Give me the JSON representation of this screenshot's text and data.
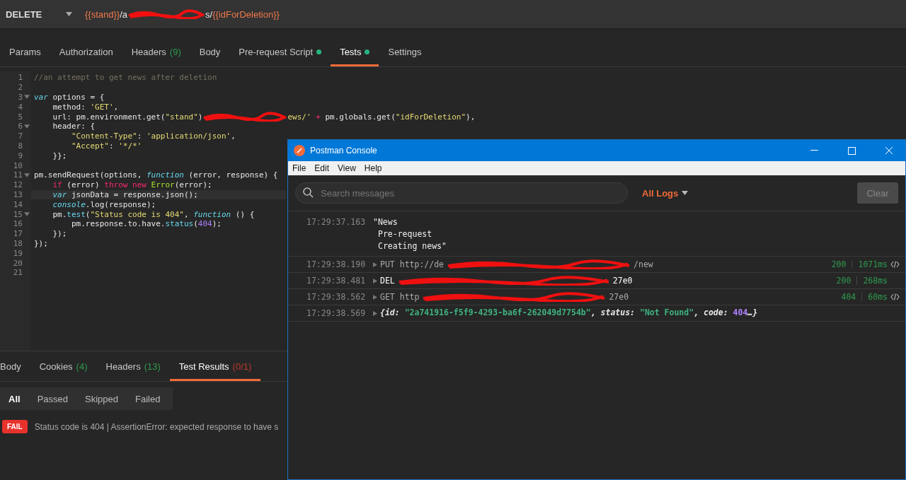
{
  "request": {
    "method": "DELETE",
    "url": [
      {
        "t": "{{stand}}",
        "kind": "var"
      },
      {
        "t": "/a",
        "kind": "plain"
      },
      {
        "kind": "redaction"
      },
      {
        "t": "s/",
        "kind": "plain"
      },
      {
        "t": "{{idForDeletion}}",
        "kind": "var"
      }
    ]
  },
  "request_tabs": [
    {
      "label": "Params",
      "selected": false
    },
    {
      "label": "Authorization",
      "selected": false
    },
    {
      "label": "Headers",
      "count": "(9)",
      "selected": false
    },
    {
      "label": "Body",
      "selected": false
    },
    {
      "label": "Pre-request Script",
      "dot": true,
      "selected": false
    },
    {
      "label": "Tests",
      "dot": true,
      "selected": true
    },
    {
      "label": "Settings",
      "selected": false
    }
  ],
  "editor": {
    "lines": [
      {
        "n": "1",
        "foldable": false,
        "current": false,
        "tokens": [
          {
            "t": "//an attempt to get news after deletion",
            "kind": "comment"
          }
        ]
      },
      {
        "n": "2",
        "foldable": false,
        "current": false
      },
      {
        "n": "3",
        "foldable": true,
        "current": false,
        "tokens": [
          {
            "t": "var",
            "kind": "keyword"
          },
          {
            "t": " options = {",
            "kind": "plain"
          }
        ]
      },
      {
        "n": "4",
        "foldable": false,
        "current": false,
        "tokens": [
          {
            "t": "    method: ",
            "kind": "plain"
          },
          {
            "t": "'GET'",
            "kind": "string"
          },
          {
            "t": ",",
            "kind": "plain"
          }
        ]
      },
      {
        "n": "5",
        "foldable": false,
        "current": false,
        "tokens": [
          {
            "t": "    url: pm.environment.get(",
            "kind": "plain"
          },
          {
            "t": "\"stand\"",
            "kind": "string"
          },
          {
            "t": ")",
            "kind": "plain"
          },
          {
            "kind": "redaction"
          },
          {
            "t": "ews/'",
            "kind": "string"
          },
          {
            "t": " + ",
            "kind": "operator"
          },
          {
            "t": "pm.globals.get(",
            "kind": "plain"
          },
          {
            "t": "\"idForDeletion\"",
            "kind": "string"
          },
          {
            "t": "),",
            "kind": "plain"
          }
        ]
      },
      {
        "n": "6",
        "foldable": true,
        "current": false,
        "tokens": [
          {
            "t": "    header: {",
            "kind": "plain"
          }
        ]
      },
      {
        "n": "7",
        "foldable": false,
        "current": false,
        "tokens": [
          {
            "t": "        \"Content-Type\"",
            "kind": "string"
          },
          {
            "t": ": ",
            "kind": "plain"
          },
          {
            "t": "'application/json'",
            "kind": "string"
          },
          {
            "t": ",",
            "kind": "plain"
          }
        ]
      },
      {
        "n": "8",
        "foldable": false,
        "current": false,
        "tokens": [
          {
            "t": "        \"Accept\"",
            "kind": "string"
          },
          {
            "t": ": ",
            "kind": "plain"
          },
          {
            "t": "'*/*'",
            "kind": "string"
          }
        ]
      },
      {
        "n": "9",
        "foldable": false,
        "current": false,
        "tokens": [
          {
            "t": "    }};",
            "kind": "plain"
          }
        ]
      },
      {
        "n": "10",
        "foldable": false,
        "current": false
      },
      {
        "n": "11",
        "foldable": true,
        "current": false,
        "tokens": [
          {
            "t": "pm.sendRequest(options, ",
            "kind": "plain"
          },
          {
            "t": "function",
            "kind": "keyword"
          },
          {
            "t": " (error, response) {",
            "kind": "plain"
          }
        ]
      },
      {
        "n": "12",
        "foldable": false,
        "current": false,
        "tokens": [
          {
            "t": "    if",
            "kind": "operator"
          },
          {
            "t": " (error) ",
            "kind": "plain"
          },
          {
            "t": "throw new",
            "kind": "operator"
          },
          {
            "t": " Error",
            "kind": "class"
          },
          {
            "t": "(error);",
            "kind": "plain"
          }
        ]
      },
      {
        "n": "13",
        "foldable": false,
        "current": true,
        "tokens": [
          {
            "t": "    var",
            "kind": "keyword"
          },
          {
            "t": " jsonData = response.json();",
            "kind": "plain"
          }
        ]
      },
      {
        "n": "14",
        "foldable": false,
        "current": false,
        "tokens": [
          {
            "t": "    console",
            "kind": "keyword"
          },
          {
            "t": ".log(response);",
            "kind": "plain"
          }
        ]
      },
      {
        "n": "15",
        "foldable": true,
        "current": false,
        "tokens": [
          {
            "t": "    pm.",
            "kind": "plain"
          },
          {
            "t": "test",
            "kind": "function"
          },
          {
            "t": "(",
            "kind": "plain"
          },
          {
            "t": "\"Status code is 404\"",
            "kind": "string"
          },
          {
            "t": ", ",
            "kind": "plain"
          },
          {
            "t": "function",
            "kind": "keyword"
          },
          {
            "t": " () {",
            "kind": "plain"
          }
        ]
      },
      {
        "n": "16",
        "foldable": false,
        "current": false,
        "tokens": [
          {
            "t": "        pm.response.to.have.",
            "kind": "plain"
          },
          {
            "t": "status",
            "kind": "function"
          },
          {
            "t": "(",
            "kind": "plain"
          },
          {
            "t": "404",
            "kind": "number"
          },
          {
            "t": ");",
            "kind": "plain"
          }
        ]
      },
      {
        "n": "17",
        "foldable": false,
        "current": false,
        "tokens": [
          {
            "t": "    });",
            "kind": "plain"
          }
        ]
      },
      {
        "n": "18",
        "foldable": false,
        "current": false,
        "tokens": [
          {
            "t": "});",
            "kind": "plain"
          }
        ]
      },
      {
        "n": "19",
        "foldable": false,
        "current": false
      },
      {
        "n": "20",
        "foldable": false,
        "current": false
      },
      {
        "n": "21",
        "foldable": false,
        "current": false
      }
    ]
  },
  "response_tabs": [
    {
      "label": "Body",
      "selected": false
    },
    {
      "label": "Cookies",
      "count": {
        "text": "(4)",
        "color": "#2e9a4e"
      },
      "selected": false
    },
    {
      "label": "Headers",
      "count": {
        "text": "(13)",
        "color": "#2e9a4e"
      },
      "selected": false
    },
    {
      "label": "Test Results",
      "count": {
        "text": "(0/1)",
        "color": "#c0392b"
      },
      "selected": true
    }
  ],
  "result_filters": [
    {
      "label": "All",
      "selected": true
    },
    {
      "label": "Passed",
      "selected": false
    },
    {
      "label": "Skipped",
      "selected": false
    },
    {
      "label": "Failed",
      "selected": false
    }
  ],
  "results": [
    {
      "status": "FAIL",
      "kind": "fail",
      "message": "Status code is 404 | AssertionError: expected response to have s"
    }
  ],
  "console": {
    "title": "Postman Console",
    "menu": [
      "File",
      "Edit",
      "View",
      "Help"
    ],
    "search": {
      "placeholder": "Search messages"
    },
    "filter": "All Logs",
    "clear_button": {
      "label": "Clear",
      "disabled": true
    },
    "entries": [
      {
        "time": "17:29:37.163",
        "kind": "text",
        "lines": [
          "\"News",
          "Pre-request",
          "Creating news\""
        ]
      },
      {
        "time": "17:29:38.190",
        "kind": "request",
        "expandable": true,
        "method": "PUT",
        "url_start": "http://de",
        "url_end": "/new",
        "status": "200",
        "duration": "1071ms",
        "code_icon": true,
        "dim": true
      },
      {
        "time": "17:29:38.481",
        "kind": "request",
        "expandable": true,
        "method": "DEL",
        "url_end": "27e0",
        "status": "200",
        "duration": "268ms",
        "code_icon": false,
        "dim": false
      },
      {
        "time": "17:29:38.562",
        "kind": "request",
        "expandable": true,
        "method": "GET",
        "url_start": "http",
        "url_end": "27e0",
        "status": "404",
        "duration": "60ms",
        "code_icon": true,
        "dim": true
      },
      {
        "time": "17:29:38.569",
        "kind": "object",
        "expandable": true,
        "tokens": [
          {
            "t": "{id: ",
            "kind": "key"
          },
          {
            "t": "\"2a741916-f5f9-4293-ba6f-262049d7754b\"",
            "kind": "string"
          },
          {
            "t": ", status: ",
            "kind": "key"
          },
          {
            "t": "\"Not Found\"",
            "kind": "string"
          },
          {
            "t": ", code: ",
            "kind": "key"
          },
          {
            "t": "404",
            "kind": "number"
          },
          {
            "t": "…}",
            "kind": "key"
          }
        ]
      }
    ]
  }
}
